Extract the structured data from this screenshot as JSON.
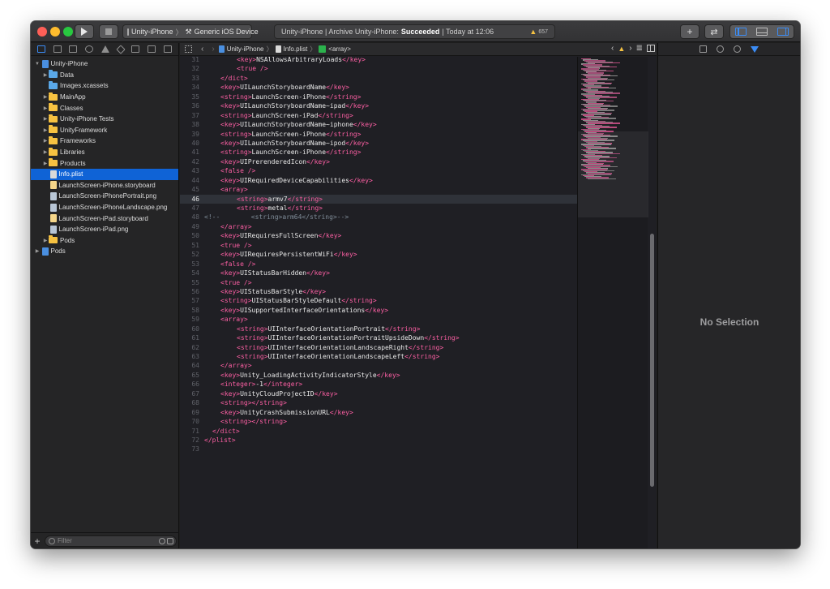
{
  "toolbar": {
    "scheme_target": "Unity-iPhone",
    "scheme_device": "Generic iOS Device",
    "activity_prefix": "Unity-iPhone | Archive Unity-iPhone:",
    "activity_status": "Succeeded",
    "activity_time": "| Today at 12:06",
    "warning_count": "657"
  },
  "navigator": {
    "filter_placeholder": "Filter",
    "items": [
      {
        "label": "Unity-iPhone",
        "indent": 0,
        "disclosure": "▼",
        "icon": "project"
      },
      {
        "label": "Data",
        "indent": 1,
        "disclosure": "▶",
        "icon": "folder-blue"
      },
      {
        "label": "Images.xcassets",
        "indent": 1,
        "disclosure": "",
        "icon": "folder-blue"
      },
      {
        "label": "MainApp",
        "indent": 1,
        "disclosure": "▶",
        "icon": "folder"
      },
      {
        "label": "Classes",
        "indent": 1,
        "disclosure": "▶",
        "icon": "folder"
      },
      {
        "label": "Unity-iPhone Tests",
        "indent": 1,
        "disclosure": "▶",
        "icon": "folder"
      },
      {
        "label": "UnityFramework",
        "indent": 1,
        "disclosure": "▶",
        "icon": "folder"
      },
      {
        "label": "Frameworks",
        "indent": 1,
        "disclosure": "▶",
        "icon": "folder"
      },
      {
        "label": "Libraries",
        "indent": 1,
        "disclosure": "▶",
        "icon": "folder"
      },
      {
        "label": "Products",
        "indent": 1,
        "disclosure": "▶",
        "icon": "folder"
      },
      {
        "label": "Info.plist",
        "indent": 1,
        "disclosure": "",
        "icon": "plist",
        "selected": true
      },
      {
        "label": "LaunchScreen-iPhone.storyboard",
        "indent": 1,
        "disclosure": "",
        "icon": "story"
      },
      {
        "label": "LaunchScreen-iPhonePortrait.png",
        "indent": 1,
        "disclosure": "",
        "icon": "png"
      },
      {
        "label": "LaunchScreen-iPhoneLandscape.png",
        "indent": 1,
        "disclosure": "",
        "icon": "png"
      },
      {
        "label": "LaunchScreen-iPad.storyboard",
        "indent": 1,
        "disclosure": "",
        "icon": "story"
      },
      {
        "label": "LaunchScreen-iPad.png",
        "indent": 1,
        "disclosure": "",
        "icon": "png"
      },
      {
        "label": "Pods",
        "indent": 1,
        "disclosure": "▶",
        "icon": "folder"
      },
      {
        "label": "Pods",
        "indent": 0,
        "disclosure": "▶",
        "icon": "project"
      }
    ]
  },
  "jumpbar": {
    "crumbs": [
      "Unity-iPhone",
      "Info.plist",
      "<array>"
    ]
  },
  "editor": {
    "current_line": "46",
    "lines": [
      {
        "n": "31",
        "indent": 2,
        "parts": [
          [
            "tag",
            "<key>"
          ],
          [
            "val",
            "NSAllowsArbitraryLoads"
          ],
          [
            "tag",
            "</key>"
          ]
        ]
      },
      {
        "n": "32",
        "indent": 2,
        "parts": [
          [
            "tag",
            "<true />"
          ]
        ]
      },
      {
        "n": "33",
        "indent": 1,
        "parts": [
          [
            "tag",
            "</dict>"
          ]
        ]
      },
      {
        "n": "34",
        "indent": 1,
        "parts": [
          [
            "tag",
            "<key>"
          ],
          [
            "val",
            "UILaunchStoryboardName"
          ],
          [
            "tag",
            "</key>"
          ]
        ]
      },
      {
        "n": "35",
        "indent": 1,
        "parts": [
          [
            "tag",
            "<string>"
          ],
          [
            "val",
            "LaunchScreen-iPhone"
          ],
          [
            "tag",
            "</string>"
          ]
        ]
      },
      {
        "n": "36",
        "indent": 1,
        "parts": [
          [
            "tag",
            "<key>"
          ],
          [
            "val",
            "UILaunchStoryboardName~ipad"
          ],
          [
            "tag",
            "</key>"
          ]
        ]
      },
      {
        "n": "37",
        "indent": 1,
        "parts": [
          [
            "tag",
            "<string>"
          ],
          [
            "val",
            "LaunchScreen-iPad"
          ],
          [
            "tag",
            "</string>"
          ]
        ]
      },
      {
        "n": "38",
        "indent": 1,
        "parts": [
          [
            "tag",
            "<key>"
          ],
          [
            "val",
            "UILaunchStoryboardName~iphone"
          ],
          [
            "tag",
            "</key>"
          ]
        ]
      },
      {
        "n": "39",
        "indent": 1,
        "parts": [
          [
            "tag",
            "<string>"
          ],
          [
            "val",
            "LaunchScreen-iPhone"
          ],
          [
            "tag",
            "</string>"
          ]
        ]
      },
      {
        "n": "40",
        "indent": 1,
        "parts": [
          [
            "tag",
            "<key>"
          ],
          [
            "val",
            "UILaunchStoryboardName~ipod"
          ],
          [
            "tag",
            "</key>"
          ]
        ]
      },
      {
        "n": "41",
        "indent": 1,
        "parts": [
          [
            "tag",
            "<string>"
          ],
          [
            "val",
            "LaunchScreen-iPhone"
          ],
          [
            "tag",
            "</string>"
          ]
        ]
      },
      {
        "n": "42",
        "indent": 1,
        "parts": [
          [
            "tag",
            "<key>"
          ],
          [
            "val",
            "UIPrerenderedIcon"
          ],
          [
            "tag",
            "</key>"
          ]
        ]
      },
      {
        "n": "43",
        "indent": 1,
        "parts": [
          [
            "tag",
            "<false />"
          ]
        ]
      },
      {
        "n": "44",
        "indent": 1,
        "parts": [
          [
            "tag",
            "<key>"
          ],
          [
            "val",
            "UIRequiredDeviceCapabilities"
          ],
          [
            "tag",
            "</key>"
          ]
        ]
      },
      {
        "n": "45",
        "indent": 1,
        "parts": [
          [
            "tag",
            "<array>"
          ]
        ]
      },
      {
        "n": "46",
        "indent": 2,
        "parts": [
          [
            "tag",
            "<string>"
          ],
          [
            "val",
            "armv7"
          ],
          [
            "tag",
            "</string>"
          ]
        ]
      },
      {
        "n": "47",
        "indent": 2,
        "parts": [
          [
            "tag",
            "<string>"
          ],
          [
            "val",
            "metal"
          ],
          [
            "tag",
            "</string>"
          ]
        ]
      },
      {
        "n": "48",
        "indent": 0,
        "parts": [
          [
            "cmt",
            "<!--        <string>arm64</string>-->"
          ]
        ]
      },
      {
        "n": "49",
        "indent": 1,
        "parts": [
          [
            "tag",
            "</array>"
          ]
        ]
      },
      {
        "n": "50",
        "indent": 1,
        "parts": [
          [
            "tag",
            "<key>"
          ],
          [
            "val",
            "UIRequiresFullScreen"
          ],
          [
            "tag",
            "</key>"
          ]
        ]
      },
      {
        "n": "51",
        "indent": 1,
        "parts": [
          [
            "tag",
            "<true />"
          ]
        ]
      },
      {
        "n": "52",
        "indent": 1,
        "parts": [
          [
            "tag",
            "<key>"
          ],
          [
            "val",
            "UIRequiresPersistentWiFi"
          ],
          [
            "tag",
            "</key>"
          ]
        ]
      },
      {
        "n": "53",
        "indent": 1,
        "parts": [
          [
            "tag",
            "<false />"
          ]
        ]
      },
      {
        "n": "54",
        "indent": 1,
        "parts": [
          [
            "tag",
            "<key>"
          ],
          [
            "val",
            "UIStatusBarHidden"
          ],
          [
            "tag",
            "</key>"
          ]
        ]
      },
      {
        "n": "55",
        "indent": 1,
        "parts": [
          [
            "tag",
            "<true />"
          ]
        ]
      },
      {
        "n": "56",
        "indent": 1,
        "parts": [
          [
            "tag",
            "<key>"
          ],
          [
            "val",
            "UIStatusBarStyle"
          ],
          [
            "tag",
            "</key>"
          ]
        ]
      },
      {
        "n": "57",
        "indent": 1,
        "parts": [
          [
            "tag",
            "<string>"
          ],
          [
            "val",
            "UIStatusBarStyleDefault"
          ],
          [
            "tag",
            "</string>"
          ]
        ]
      },
      {
        "n": "58",
        "indent": 1,
        "parts": [
          [
            "tag",
            "<key>"
          ],
          [
            "val",
            "UISupportedInterfaceOrientations"
          ],
          [
            "tag",
            "</key>"
          ]
        ]
      },
      {
        "n": "59",
        "indent": 1,
        "parts": [
          [
            "tag",
            "<array>"
          ]
        ]
      },
      {
        "n": "60",
        "indent": 2,
        "parts": [
          [
            "tag",
            "<string>"
          ],
          [
            "val",
            "UIInterfaceOrientationPortrait"
          ],
          [
            "tag",
            "</string>"
          ]
        ]
      },
      {
        "n": "61",
        "indent": 2,
        "parts": [
          [
            "tag",
            "<string>"
          ],
          [
            "val",
            "UIInterfaceOrientationPortraitUpsideDown"
          ],
          [
            "tag",
            "</string>"
          ]
        ]
      },
      {
        "n": "62",
        "indent": 2,
        "parts": [
          [
            "tag",
            "<string>"
          ],
          [
            "val",
            "UIInterfaceOrientationLandscapeRight"
          ],
          [
            "tag",
            "</string>"
          ]
        ]
      },
      {
        "n": "63",
        "indent": 2,
        "parts": [
          [
            "tag",
            "<string>"
          ],
          [
            "val",
            "UIInterfaceOrientationLandscapeLeft"
          ],
          [
            "tag",
            "</string>"
          ]
        ]
      },
      {
        "n": "64",
        "indent": 1,
        "parts": [
          [
            "tag",
            "</array>"
          ]
        ]
      },
      {
        "n": "65",
        "indent": 1,
        "parts": [
          [
            "tag",
            "<key>"
          ],
          [
            "val",
            "Unity_LoadingActivityIndicatorStyle"
          ],
          [
            "tag",
            "</key>"
          ]
        ]
      },
      {
        "n": "66",
        "indent": 1,
        "parts": [
          [
            "tag",
            "<integer>"
          ],
          [
            "val",
            "-1"
          ],
          [
            "tag",
            "</integer>"
          ]
        ]
      },
      {
        "n": "67",
        "indent": 1,
        "parts": [
          [
            "tag",
            "<key>"
          ],
          [
            "val",
            "UnityCloudProjectID"
          ],
          [
            "tag",
            "</key>"
          ]
        ]
      },
      {
        "n": "68",
        "indent": 1,
        "parts": [
          [
            "tag",
            "<string></string>"
          ]
        ]
      },
      {
        "n": "69",
        "indent": 1,
        "parts": [
          [
            "tag",
            "<key>"
          ],
          [
            "val",
            "UnityCrashSubmissionURL"
          ],
          [
            "tag",
            "</key>"
          ]
        ]
      },
      {
        "n": "70",
        "indent": 1,
        "parts": [
          [
            "tag",
            "<string></string>"
          ]
        ]
      },
      {
        "n": "71",
        "indent": 0.5,
        "parts": [
          [
            "tag",
            "</dict>"
          ]
        ]
      },
      {
        "n": "72",
        "indent": 0,
        "parts": [
          [
            "tag",
            "</plist>"
          ]
        ]
      },
      {
        "n": "73",
        "indent": 0,
        "parts": []
      }
    ]
  },
  "inspector": {
    "empty_label": "No Selection"
  }
}
